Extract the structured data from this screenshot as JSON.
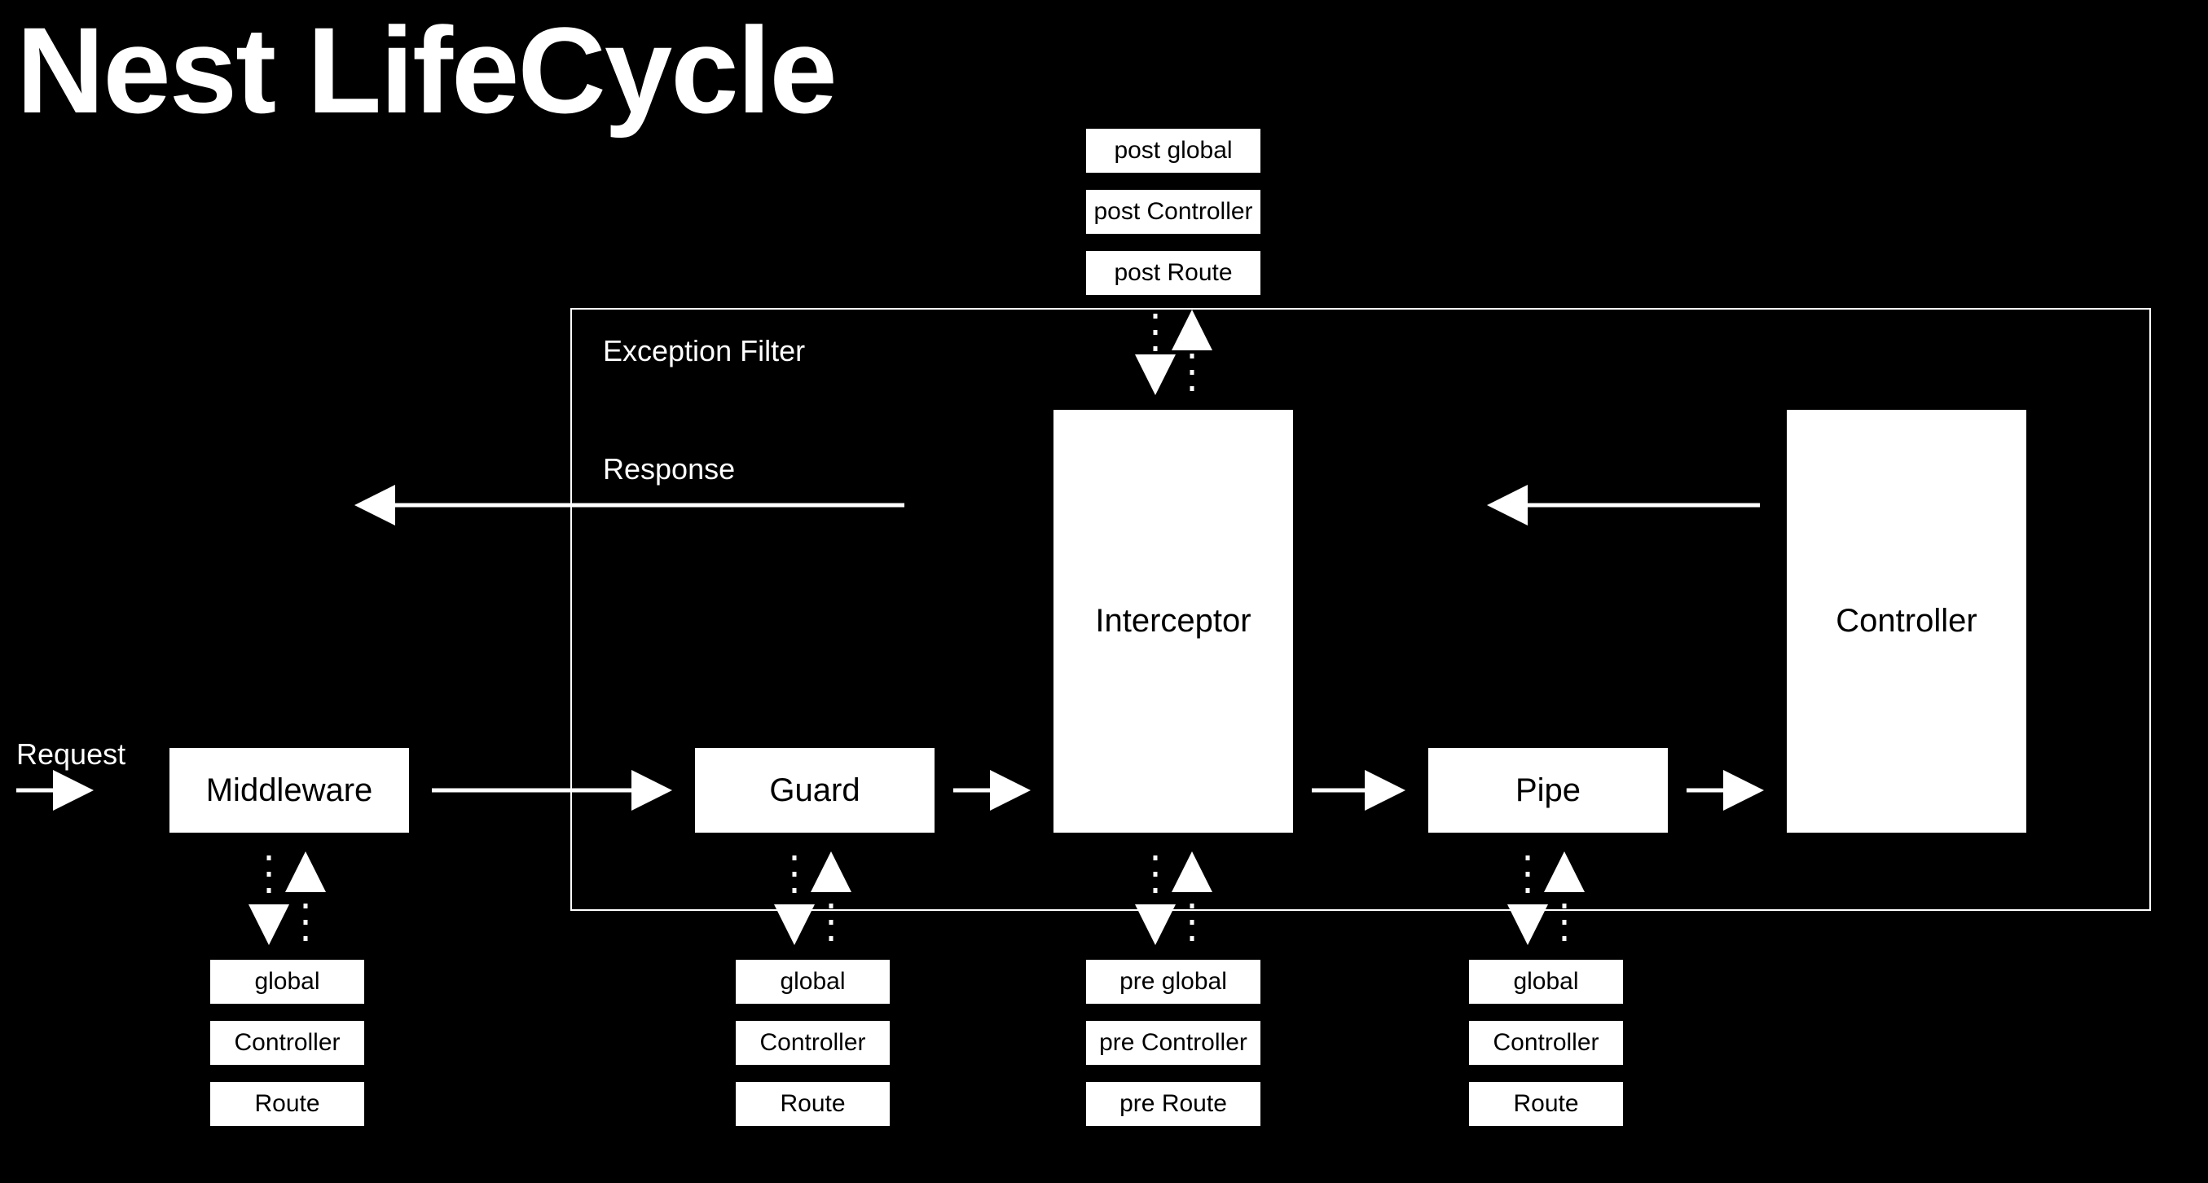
{
  "title": "Nest LifeCycle",
  "labels": {
    "request": "Request",
    "response": "Response",
    "exception_filter": "Exception Filter"
  },
  "nodes": {
    "middleware": "Middleware",
    "guard": "Guard",
    "interceptor": "Interceptor",
    "pipe": "Pipe",
    "controller": "Controller"
  },
  "middleware_stack": [
    "global",
    "Controller",
    "Route"
  ],
  "guard_stack": [
    "global",
    "Controller",
    "Route"
  ],
  "pipe_stack": [
    "global",
    "Controller",
    "Route"
  ],
  "interceptor_pre_stack": [
    "pre global",
    "pre Controller",
    "pre Route"
  ],
  "interceptor_post_stack": [
    "post global",
    "post Controller",
    "post Route"
  ]
}
